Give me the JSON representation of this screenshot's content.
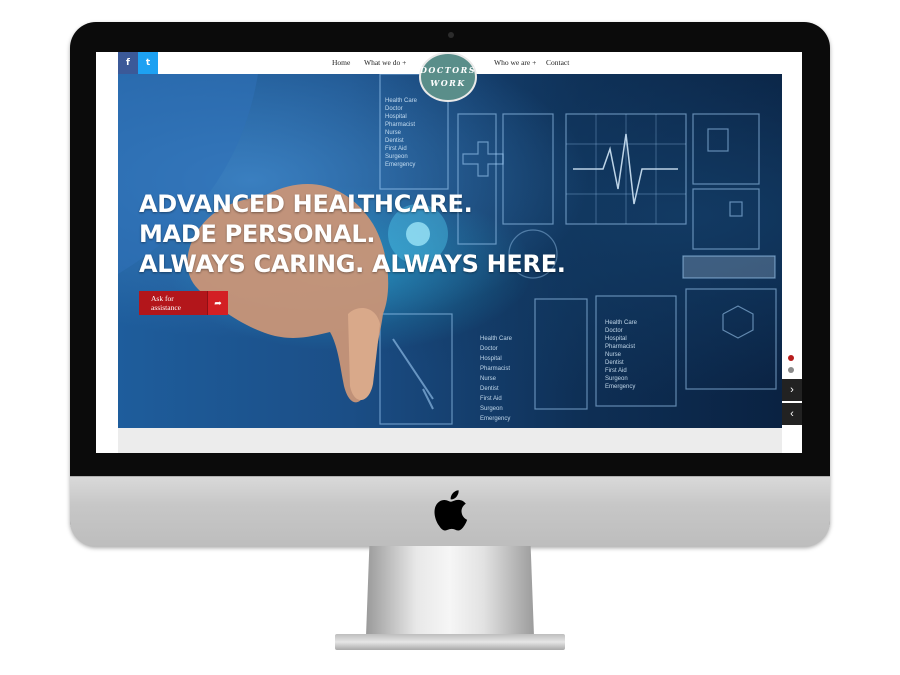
{
  "social": {
    "facebook": "f",
    "twitter": "t"
  },
  "nav": {
    "items": [
      {
        "label": "Home"
      },
      {
        "label": "What we do +"
      },
      {
        "label": "Who we are +"
      },
      {
        "label": "Contact"
      }
    ]
  },
  "logo": {
    "line1": "DOCTORS",
    "line2": "WORK"
  },
  "hero": {
    "headline": [
      "ADVANCED HEALTHCARE.",
      "MADE PERSONAL.",
      "ALWAYS CARING. ALWAYS HERE."
    ],
    "cta_label": "Ask for assistance",
    "cta_arrow": "➦"
  },
  "slider": {
    "next": "›",
    "prev": "‹",
    "active_slide": 1,
    "total_slides": 2
  },
  "colors": {
    "brand_teal": "#5a8e8a",
    "cta_red": "#b3161b",
    "facebook": "#3b5998",
    "twitter": "#1da1f2"
  }
}
